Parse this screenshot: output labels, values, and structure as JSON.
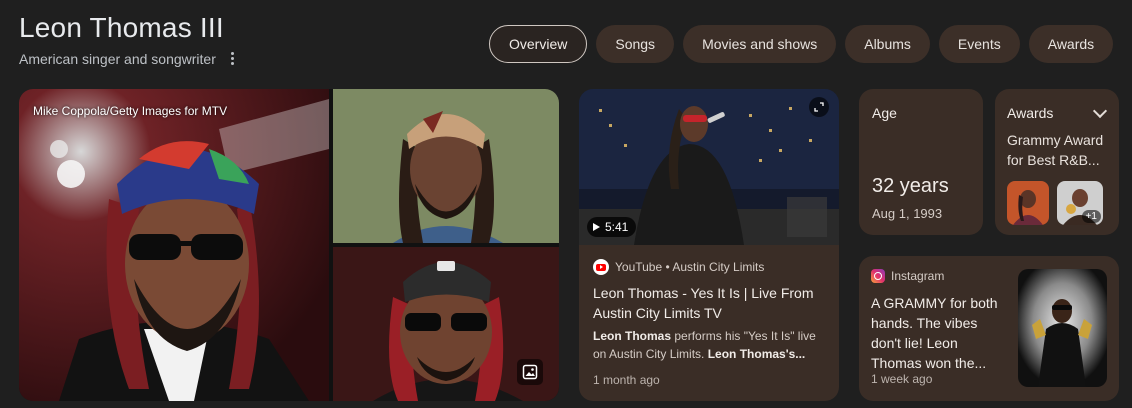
{
  "header": {
    "title": "Leon Thomas III",
    "subtitle": "American singer and songwriter"
  },
  "tabs": [
    {
      "label": "Overview",
      "active": true
    },
    {
      "label": "Songs"
    },
    {
      "label": "Movies and shows"
    },
    {
      "label": "Albums"
    },
    {
      "label": "Events"
    },
    {
      "label": "Awards"
    }
  ],
  "gallery": {
    "main_caption": "Mike Coppola/Getty Images for MTV"
  },
  "video": {
    "duration": "5:41",
    "source": "YouTube • Austin City Limits",
    "title": "Leon Thomas - Yes It Is | Live From Austin City Limits TV",
    "desc_bold1": "Leon Thomas",
    "desc_mid": " performs his \"Yes It Is\" live on Austin City Limits. ",
    "desc_bold2": "Leon Thomas's...",
    "age": "1 month ago"
  },
  "age_card": {
    "label": "Age",
    "value": "32 years",
    "birthdate": "Aug 1, 1993"
  },
  "awards_card": {
    "label": "Awards",
    "text": "Grammy Award for Best R&B...",
    "more_badge": "+1"
  },
  "instagram": {
    "source": "Instagram",
    "text": "A GRAMMY for both hands. The vibes don't lie! Leon Thomas won the...",
    "age": "1 week ago"
  },
  "colors": {
    "page_bg": "#1f1f1f",
    "card_bg": "#3a2d26",
    "youtube_red": "#ff0000",
    "instagram_pink": "#e1306c"
  }
}
